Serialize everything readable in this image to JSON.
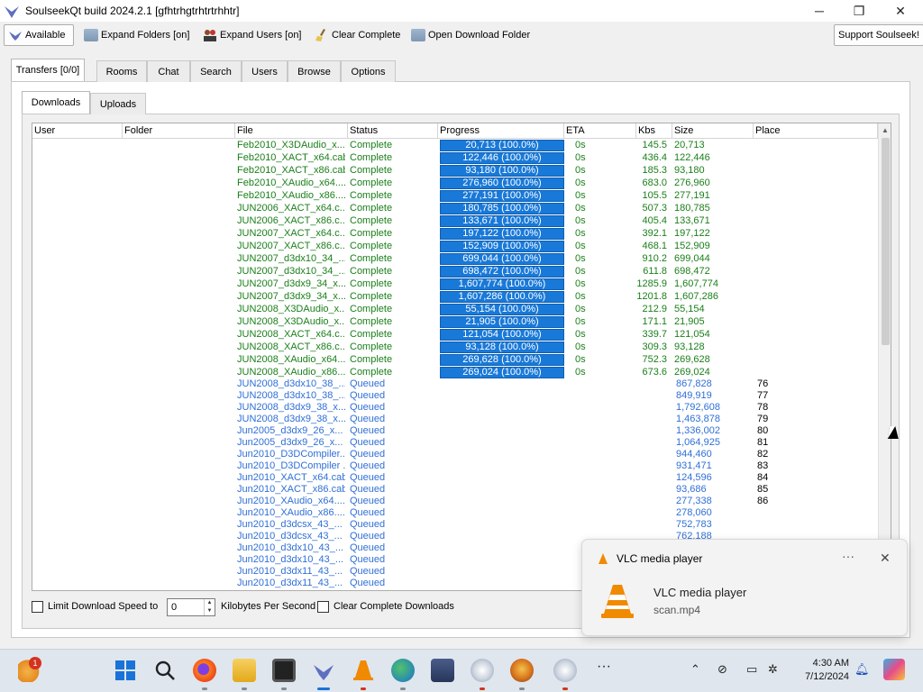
{
  "window": {
    "title": "SoulseekQt build 2024.2.1 [gfhtrhgtrhtrtrhhtr]",
    "min": "─",
    "max": "❐",
    "close": "✕"
  },
  "toolbar": {
    "available": "Available",
    "expand_folders": "Expand Folders [on]",
    "expand_users": "Expand Users [on]",
    "clear_complete": "Clear Complete",
    "open_download_folder": "Open Download Folder",
    "support": "Support Soulseek!"
  },
  "main_tabs": [
    "Transfers [0/0]",
    "Rooms",
    "Chat",
    "Search",
    "Users",
    "Browse",
    "Options"
  ],
  "sub_tabs": [
    "Downloads",
    "Uploads"
  ],
  "columns": [
    "User",
    "Folder",
    "File",
    "Status",
    "Progress",
    "ETA",
    "Kbs",
    "Size",
    "Place"
  ],
  "completed": [
    {
      "file": "Feb2010_X3DAudio_x...",
      "status": "Complete",
      "progress": "20,713 (100.0%)",
      "eta": "0s",
      "kbs": "145.5",
      "size": "20,713"
    },
    {
      "file": "Feb2010_XACT_x64.cab",
      "status": "Complete",
      "progress": "122,446 (100.0%)",
      "eta": "0s",
      "kbs": "436.4",
      "size": "122,446"
    },
    {
      "file": "Feb2010_XACT_x86.cab",
      "status": "Complete",
      "progress": "93,180 (100.0%)",
      "eta": "0s",
      "kbs": "185.3",
      "size": "93,180"
    },
    {
      "file": "Feb2010_XAudio_x64....",
      "status": "Complete",
      "progress": "276,960 (100.0%)",
      "eta": "0s",
      "kbs": "683.0",
      "size": "276,960"
    },
    {
      "file": "Feb2010_XAudio_x86....",
      "status": "Complete",
      "progress": "277,191 (100.0%)",
      "eta": "0s",
      "kbs": "105.5",
      "size": "277,191"
    },
    {
      "file": "JUN2006_XACT_x64.c...",
      "status": "Complete",
      "progress": "180,785 (100.0%)",
      "eta": "0s",
      "kbs": "507.3",
      "size": "180,785"
    },
    {
      "file": "JUN2006_XACT_x86.c...",
      "status": "Complete",
      "progress": "133,671 (100.0%)",
      "eta": "0s",
      "kbs": "405.4",
      "size": "133,671"
    },
    {
      "file": "JUN2007_XACT_x64.c...",
      "status": "Complete",
      "progress": "197,122 (100.0%)",
      "eta": "0s",
      "kbs": "392.1",
      "size": "197,122"
    },
    {
      "file": "JUN2007_XACT_x86.c...",
      "status": "Complete",
      "progress": "152,909 (100.0%)",
      "eta": "0s",
      "kbs": "468.1",
      "size": "152,909"
    },
    {
      "file": "JUN2007_d3dx10_34_...",
      "status": "Complete",
      "progress": "699,044 (100.0%)",
      "eta": "0s",
      "kbs": "910.2",
      "size": "699,044"
    },
    {
      "file": "JUN2007_d3dx10_34_...",
      "status": "Complete",
      "progress": "698,472 (100.0%)",
      "eta": "0s",
      "kbs": "611.8",
      "size": "698,472"
    },
    {
      "file": "JUN2007_d3dx9_34_x...",
      "status": "Complete",
      "progress": "1,607,774 (100.0%)",
      "eta": "0s",
      "kbs": "1285.9",
      "size": "1,607,774"
    },
    {
      "file": "JUN2007_d3dx9_34_x...",
      "status": "Complete",
      "progress": "1,607,286 (100.0%)",
      "eta": "0s",
      "kbs": "1201.8",
      "size": "1,607,286"
    },
    {
      "file": "JUN2008_X3DAudio_x...",
      "status": "Complete",
      "progress": "55,154 (100.0%)",
      "eta": "0s",
      "kbs": "212.9",
      "size": "55,154"
    },
    {
      "file": "JUN2008_X3DAudio_x...",
      "status": "Complete",
      "progress": "21,905 (100.0%)",
      "eta": "0s",
      "kbs": "171.1",
      "size": "21,905"
    },
    {
      "file": "JUN2008_XACT_x64.c...",
      "status": "Complete",
      "progress": "121,054 (100.0%)",
      "eta": "0s",
      "kbs": "339.7",
      "size": "121,054"
    },
    {
      "file": "JUN2008_XACT_x86.c...",
      "status": "Complete",
      "progress": "93,128 (100.0%)",
      "eta": "0s",
      "kbs": "309.3",
      "size": "93,128"
    },
    {
      "file": "JUN2008_XAudio_x64....",
      "status": "Complete",
      "progress": "269,628 (100.0%)",
      "eta": "0s",
      "kbs": "752.3",
      "size": "269,628"
    },
    {
      "file": "JUN2008_XAudio_x86....",
      "status": "Complete",
      "progress": "269,024 (100.0%)",
      "eta": "0s",
      "kbs": "673.6",
      "size": "269,024"
    }
  ],
  "queued": [
    {
      "file": "JUN2008_d3dx10_38_...",
      "status": "Queued",
      "size": "867,828",
      "place": "76"
    },
    {
      "file": "JUN2008_d3dx10_38_...",
      "status": "Queued",
      "size": "849,919",
      "place": "77"
    },
    {
      "file": "JUN2008_d3dx9_38_x...",
      "status": "Queued",
      "size": "1,792,608",
      "place": "78"
    },
    {
      "file": "JUN2008_d3dx9_38_x...",
      "status": "Queued",
      "size": "1,463,878",
      "place": "79"
    },
    {
      "file": "Jun2005_d3dx9_26_x...",
      "status": "Queued",
      "size": "1,336,002",
      "place": "80"
    },
    {
      "file": "Jun2005_d3dx9_26_x...",
      "status": "Queued",
      "size": "1,064,925",
      "place": "81"
    },
    {
      "file": "Jun2010_D3DCompiler...",
      "status": "Queued",
      "size": "944,460",
      "place": "82"
    },
    {
      "file": "Jun2010_D3DCompiler ...",
      "status": "Queued",
      "size": "931,471",
      "place": "83"
    },
    {
      "file": "Jun2010_XACT_x64.cab",
      "status": "Queued",
      "size": "124,596",
      "place": "84"
    },
    {
      "file": "Jun2010_XACT_x86.cab",
      "status": "Queued",
      "size": "93,686",
      "place": "85"
    },
    {
      "file": "Jun2010_XAudio_x64....",
      "status": "Queued",
      "size": "277,338",
      "place": "86"
    },
    {
      "file": "Jun2010_XAudio_x86....",
      "status": "Queued",
      "size": "278,060",
      "place": ""
    },
    {
      "file": "Jun2010_d3dcsx_43_...",
      "status": "Queued",
      "size": "752,783",
      "place": ""
    },
    {
      "file": "Jun2010_d3dcsx_43_...",
      "status": "Queued",
      "size": "762,188",
      "place": ""
    },
    {
      "file": "Jun2010_d3dx10_43_...",
      "status": "Queued",
      "size": "",
      "place": ""
    },
    {
      "file": "Jun2010_d3dx10_43_...",
      "status": "Queued",
      "size": "",
      "place": ""
    },
    {
      "file": "Jun2010_d3dx11_43_...",
      "status": "Queued",
      "size": "",
      "place": ""
    },
    {
      "file": "Jun2010_d3dx11_43_...",
      "status": "Queued",
      "size": "",
      "place": ""
    }
  ],
  "bottom": {
    "limit_label": "Limit Download Speed to",
    "limit_value": "0",
    "unit": "Kilobytes Per Second",
    "clear_complete_downloads": "Clear Complete Downloads"
  },
  "toast": {
    "app": "VLC media player",
    "title": "VLC media player",
    "body": "scan.mp4",
    "more": "···",
    "close": "✕"
  },
  "taskbar": {
    "time": "4:30 AM",
    "date": "7/12/2024",
    "badge": "1"
  },
  "colors": {
    "complete_text": "#1a7f1a",
    "queued_text": "#2f6fd6",
    "progress_fill": "#1979d8"
  }
}
